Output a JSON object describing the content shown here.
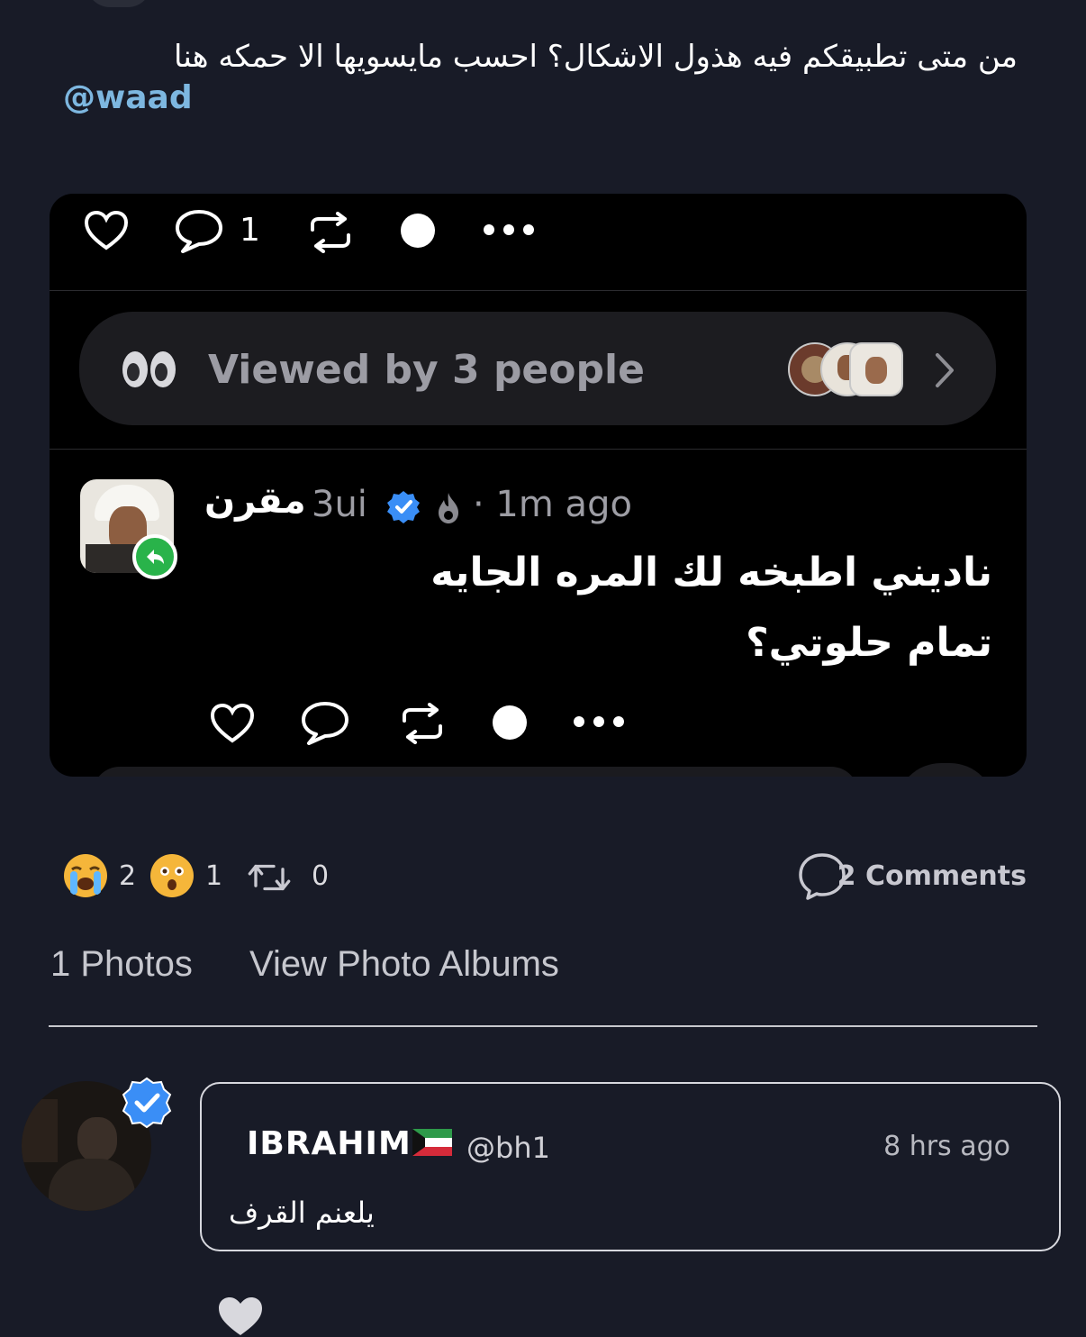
{
  "post": {
    "text": "من متى تطبيقكم فيه هذول الاشكال؟ احسب مايسويها الا حمكه هنا",
    "mention": "@waad"
  },
  "screenshot_card": {
    "comment_count": "1",
    "viewed_text": "Viewed by 3 people",
    "reply": {
      "name": "مقرن",
      "handle": "3ui",
      "time": "· 1m ago",
      "line1": "ناديني اطبخه لك المره الجايه",
      "line2": "تمام حلوتي؟"
    }
  },
  "reactions": {
    "crying": "2",
    "astonished": "1",
    "reposts": "0",
    "comments_label": "2 Comments"
  },
  "photos": {
    "count_label": "1 Photos",
    "albums_label": "View Photo Albums"
  },
  "comment": {
    "name": "IBRAHIM",
    "handle": "@bh1",
    "time": "8 hrs ago",
    "text": "يلعنم القرف"
  },
  "colors": {
    "background": "#181b27",
    "mention": "#7db7e0",
    "verified": "#3a8ef6",
    "reply_badge": "#29b34a"
  }
}
